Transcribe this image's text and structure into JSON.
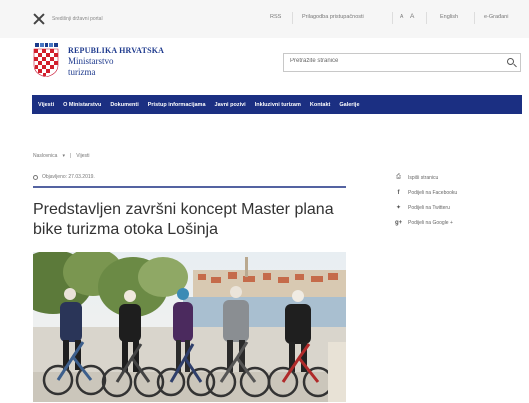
{
  "topbar": {
    "gov_label": "Središnji državni portal",
    "link_rss": "RSS",
    "link_accessibility": "Prilagodba pristupačnosti",
    "font_small": "A",
    "font_large": "A",
    "lang_en": "English",
    "lang_hr": "e-Građani"
  },
  "brand": {
    "line1": "REPUBLIKA HRVATSKA",
    "line2": "Ministarstvo",
    "line3": "turizma"
  },
  "search": {
    "placeholder": "Pretražite stranice"
  },
  "nav": {
    "items": [
      "Vijesti",
      "O Ministarstvu",
      "Dokumenti",
      "Pristup informacijama",
      "Javni pozivi",
      "Inkluzivni turizam",
      "Kontakt",
      "Galerije"
    ]
  },
  "breadcrumb": {
    "home": "Naslovnica",
    "current": "Vijesti"
  },
  "article": {
    "published": "Objavljeno: 27.03.2019.",
    "title": "Predstavljen završni koncept Master plana bike turizma otoka Lošinja"
  },
  "share": {
    "print": "Ispiši stranicu",
    "facebook": "Podijeli na Facebooku",
    "twitter": "Podijeli na Twitteru",
    "google": "Podijeli na Google +"
  },
  "colors": {
    "nav_bg": "#1b2f82",
    "brand_text": "#1f3b8e"
  }
}
